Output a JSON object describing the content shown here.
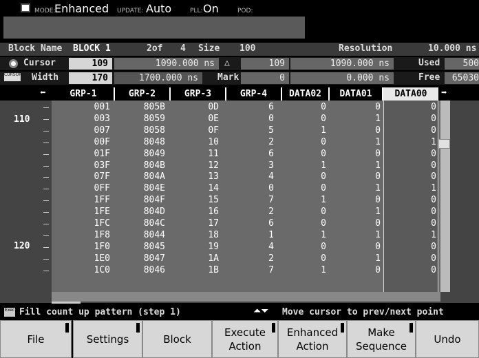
{
  "status": {
    "mode_label": "MODE:",
    "mode_value": "Enhanced",
    "update_label": "UPDATE:",
    "update_value": "Auto",
    "pll_label": "PLL:",
    "pll_value": "On",
    "pod_label": "POD:"
  },
  "block": {
    "name_label": "Block Name",
    "name_value": "BLOCK 1",
    "index": "2of",
    "count": "4",
    "size_label": "Size",
    "size_value": "100",
    "resolution_label": "Resolution",
    "resolution_value": "10.000 ns"
  },
  "cursor": {
    "label": "Cursor",
    "value": "109",
    "time": "1090.000 ns",
    "delta_symbol": "△",
    "delta_value": "109",
    "delta_time": "1090.000 ns",
    "used_label": "Used",
    "used_value": "500"
  },
  "width": {
    "icon_text": "CURSOR",
    "label": "Width",
    "value": "170",
    "time": "1700.000 ns",
    "mark_label": "Mark",
    "mark_value": "0",
    "mark_time": "0.000 ns",
    "free_label": "Free",
    "free_value": "65030"
  },
  "columns": [
    "GRP-1",
    "GRP-2",
    "GRP-3",
    "GRP-4",
    "DATA02",
    "DATA01",
    "DATA00"
  ],
  "selected_column": "DATA00",
  "rows": [
    [
      "001",
      "805B",
      "0D",
      "6",
      "0",
      "0",
      "0"
    ],
    [
      "003",
      "8059",
      "0E",
      "0",
      "0",
      "1",
      "0"
    ],
    [
      "007",
      "8058",
      "0F",
      "5",
      "1",
      "0",
      "0"
    ],
    [
      "00F",
      "8048",
      "10",
      "2",
      "0",
      "1",
      "1"
    ],
    [
      "01F",
      "8049",
      "11",
      "6",
      "0",
      "0",
      "0"
    ],
    [
      "03F",
      "804B",
      "12",
      "3",
      "1",
      "1",
      "0"
    ],
    [
      "07F",
      "804A",
      "13",
      "4",
      "0",
      "0",
      "0"
    ],
    [
      "0FF",
      "804E",
      "14",
      "0",
      "0",
      "1",
      "1"
    ],
    [
      "1FF",
      "804F",
      "15",
      "7",
      "1",
      "0",
      "0"
    ],
    [
      "1FE",
      "804D",
      "16",
      "2",
      "0",
      "1",
      "0"
    ],
    [
      "1FC",
      "804C",
      "17",
      "6",
      "0",
      "0",
      "0"
    ],
    [
      "1F8",
      "8044",
      "18",
      "1",
      "1",
      "1",
      "1"
    ],
    [
      "1F0",
      "8045",
      "19",
      "4",
      "0",
      "0",
      "0"
    ],
    [
      "1E0",
      "8047",
      "1A",
      "2",
      "0",
      "1",
      "0"
    ],
    [
      "1C0",
      "8046",
      "1B",
      "7",
      "1",
      "0",
      "0"
    ]
  ],
  "y_labels": {
    "a": "110",
    "b": "120"
  },
  "bottom": {
    "exec_icon": "Exec",
    "left_message": "Fill count up pattern (step 1)",
    "right_message": "Move cursor to prev/next point"
  },
  "buttons": [
    {
      "label": "File",
      "mark": true
    },
    {
      "label": "Settings",
      "mark": true
    },
    {
      "label": "Block",
      "mark": false
    },
    {
      "label": "Execute\nAction",
      "mark": true
    },
    {
      "label": "Enhanced\nAction",
      "mark": true
    },
    {
      "label": "Make\nSequence",
      "mark": true
    },
    {
      "label": "Undo",
      "mark": false
    }
  ]
}
